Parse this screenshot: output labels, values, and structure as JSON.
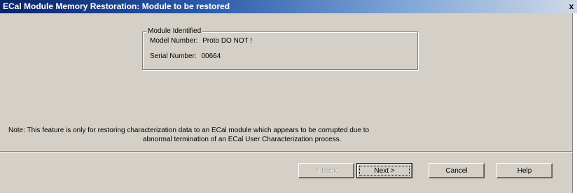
{
  "window": {
    "title": "ECal Module Memory Restoration: Module to be restored",
    "close_glyph": "x"
  },
  "module_group": {
    "legend": "Module Identified",
    "model_label": "Model Number:",
    "model_value": "Proto DO NOT !",
    "serial_label": "Serial Number:",
    "serial_value": "00664"
  },
  "note": {
    "line1": "Note:  This feature is only for restoring characterization data to an ECal module which appears to be corrupted due to",
    "line2": "abnormal termination of an ECal User Characterization process."
  },
  "buttons": {
    "back": "< Back",
    "next": "Next >",
    "cancel": "Cancel",
    "help": "Help"
  }
}
